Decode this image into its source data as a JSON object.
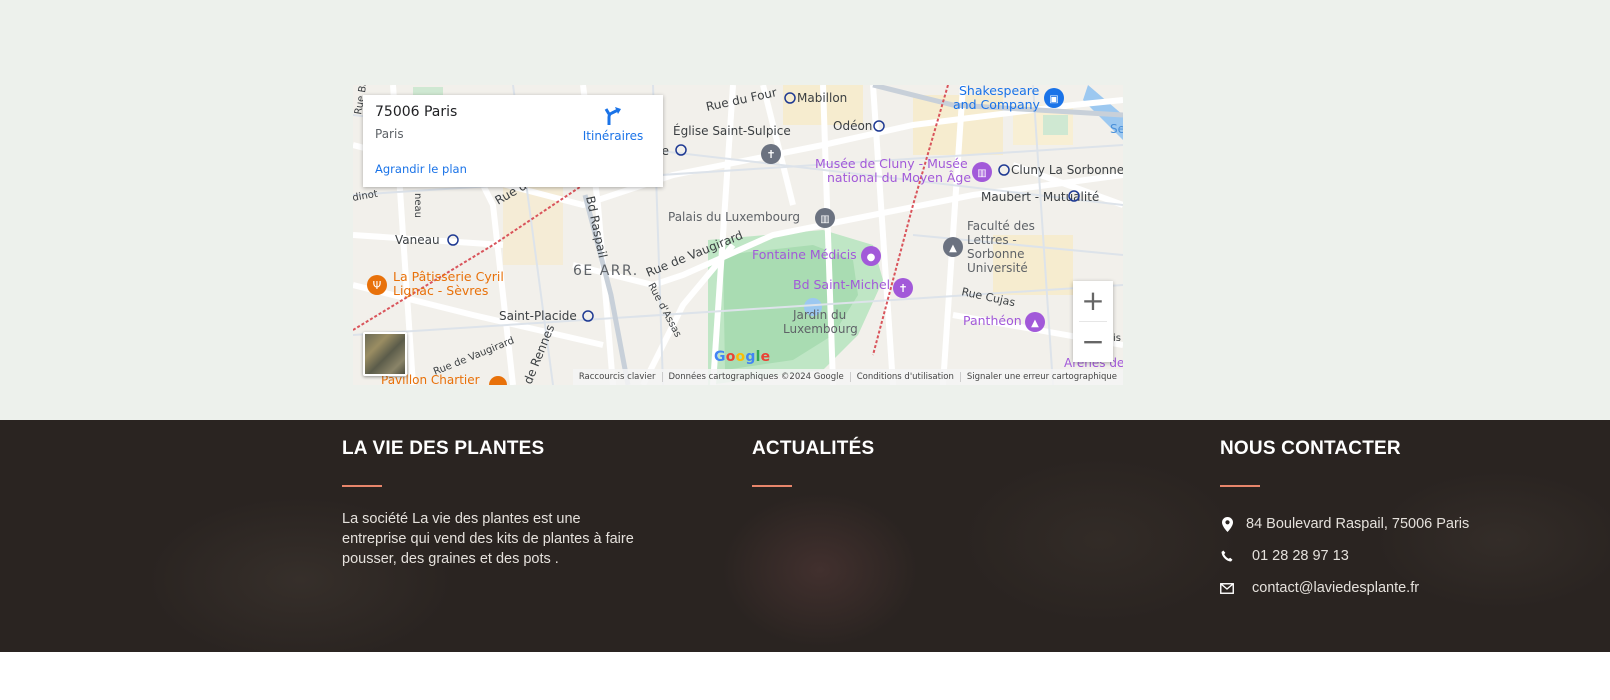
{
  "map": {
    "card": {
      "title": "75006 Paris",
      "subtitle": "Paris",
      "directions_label": "Itinéraires",
      "enlarge_label": "Agrandir le plan"
    },
    "labels": {
      "rue_du_four": "Rue du Four",
      "mabillon": "Mabillon",
      "eglise": "Église Saint-Sulpice",
      "odeon": "Odéon",
      "shakespeare1": "Shakespeare",
      "shakespeare2": "and Company",
      "cluny1": "Musée de Cluny - Musée",
      "cluny2": "national du Moyen Âge",
      "cluny_sorbonne": "Cluny La Sorbonne",
      "maubert": "Maubert - Mutualité",
      "palais": "Palais du Luxembourg",
      "faculte1": "Faculté des",
      "faculte2": "Lettres -",
      "faculte3": "Sorbonne",
      "faculte4": "Université",
      "fontaine": "Fontaine Médicis",
      "bd_st_michel": "Bd Saint-Michel",
      "rue_cujas": "Rue Cujas",
      "pantheon": "Panthéon",
      "jardin1": "Jardin du",
      "jardin2": "Luxembourg",
      "arenes": "Arenes de",
      "rue_vaugirard": "Rue de Vaugirard",
      "rue_vaugirard2": "Rue de Vaugirard",
      "arr": "6E ARR.",
      "bd_raspail": "Bd Raspail",
      "rue_assas": "Rue d'Assas",
      "rue_rennes": "de Rennes",
      "saint_placide": "Saint-Placide",
      "vaneau": "Vaneau",
      "patisserie1": "La Pâtisserie Cyril",
      "patisserie2": "Lignac - Sèvres",
      "rue_de": "Rue de",
      "rue_ba": "Rue Ba",
      "neau": "neau",
      "dinot": "dinot",
      "ce": "ce",
      "pavillon": "Pavillon Chartier",
      "se": "Se",
      "is": "is"
    },
    "attribution": [
      "Raccourcis clavier",
      "Données cartographiques ©2024 Google",
      "Conditions d'utilisation",
      "Signaler une erreur cartographique"
    ],
    "zoom_in": "+",
    "zoom_out": "−",
    "google_letters": [
      "G",
      "o",
      "o",
      "g",
      "l",
      "e"
    ]
  },
  "footer": {
    "col1": {
      "title": "LA VIE DES PLANTES",
      "text": "La société La vie des plantes est une entreprise qui vend des kits de plantes à faire pousser, des graines et des pots ."
    },
    "col2": {
      "title": "ACTUALITÉS"
    },
    "col3": {
      "title": "NOUS CONTACTER",
      "address": "84 Boulevard Raspail, 75006 Paris",
      "phone": "01 28 28 97 13",
      "email": "contact@laviedesplante.fr"
    }
  },
  "colors": {
    "accent_line": "#e8866b",
    "footer_bg": "#2a2421",
    "map_poi_purple": "#a259d9",
    "map_poi_blue": "#1a73e8",
    "map_poi_orange": "#e8710a"
  }
}
